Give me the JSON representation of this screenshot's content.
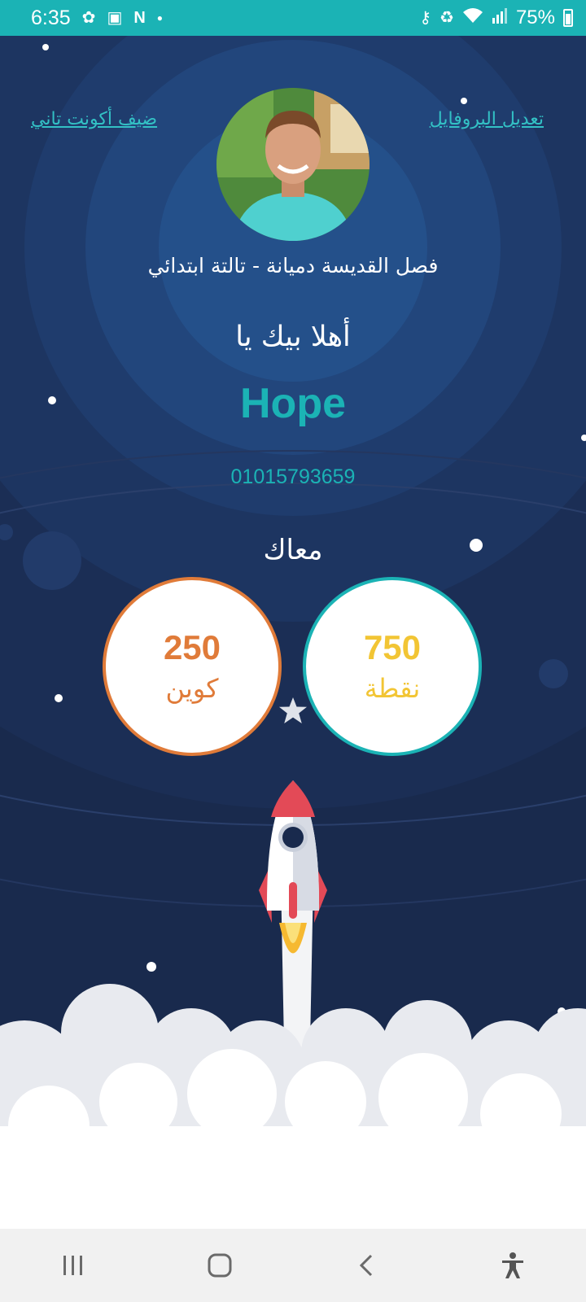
{
  "status_bar": {
    "time": "6:35",
    "battery": "75%",
    "icons_left": [
      "flower-icon",
      "image-icon",
      "n-icon",
      "dot-icon"
    ],
    "icons_right": [
      "key-icon",
      "recycle-icon",
      "wifi-icon",
      "signal-icon",
      "battery-icon"
    ]
  },
  "header": {
    "edit_profile": "تعديل البروفايل",
    "add_account": "ضيف أكونت تاني"
  },
  "profile": {
    "class_label": "فصل القديسة دميانة - تالتة ابتدائي",
    "welcome": "أهلا بيك يا",
    "name": "Hope",
    "phone": "01015793659"
  },
  "stats": {
    "heading": "معاك",
    "points": {
      "value": "750",
      "label": "نقطة"
    },
    "coins": {
      "value": "250",
      "label": "كوين"
    }
  },
  "colors": {
    "background": "#192a4d",
    "accent": "#1bb3b5",
    "points": "#f2c534",
    "coins": "#e07b39"
  },
  "nav": {
    "buttons": [
      "recents-icon",
      "home-icon",
      "back-icon",
      "accessibility-icon"
    ]
  }
}
